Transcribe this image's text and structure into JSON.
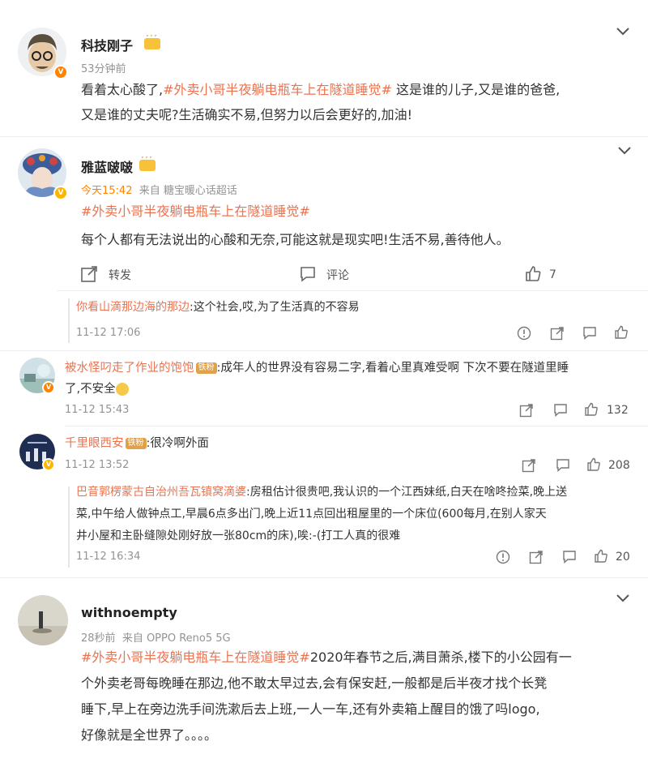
{
  "post1": {
    "username": "科技刚子",
    "time": "53分钟前",
    "body_prefix": "看着太心酸了,",
    "hashtag": "#外卖小哥半夜躺电瓶车上在隧道睡觉#",
    "body_suffix": " 这是谁的儿子,又是谁的爸爸,",
    "body_line2": "又是谁的丈夫呢?生活确实不易,但努力以后会更好的,加油!"
  },
  "post2": {
    "username": "雅蓝啵啵",
    "time": "今天15:42",
    "source": "来自 糖宝暖心话超话",
    "hashtag": "#外卖小哥半夜躺电瓶车上在隧道睡觉#",
    "body": "每个人都有无法说出的心酸和无奈,可能这就是现实吧!生活不易,善待他人。",
    "actions": {
      "repost": "转发",
      "comment": "评论",
      "like_count": "7"
    },
    "reply": {
      "name": "你看山滴那边海的那边",
      "text": ":这个社会,哎,为了生活真的不容易",
      "time": "11-12 17:06"
    }
  },
  "comment1": {
    "name": "被水怪叼走了作业的饱饱",
    "fan_tag": "铁粉",
    "text_line1": ":成年人的世界没有容易二字,看着心里真难受啊 下次不要在隧道里睡",
    "text_line2": "了,不安全",
    "time": "11-12 15:43",
    "like_count": "132"
  },
  "comment2": {
    "name": "千里眼西安",
    "fan_tag": "铁粉",
    "text": ":很冷啊外面",
    "time": "11-12 13:52",
    "like_count": "208",
    "reply": {
      "name": "巴音郭楞蒙古自治州吾瓦镇窝滴婆",
      "line1": ":房租估计很贵吧,我认识的一个江西妹纸,白天在啥咚捡菜,晚上送",
      "line2": "菜,中午给人做钟点工,早晨6点多出门,晚上近11点回出租屋里的一个床位(600每月,在别人家天",
      "line3": "井小屋和主卧缝隙处刚好放一张80cm的床),唉:-(打工人真的很难",
      "time": "11-12 16:34",
      "like_count": "20"
    }
  },
  "post3": {
    "username": "withnoempty",
    "time": "28秒前",
    "source": "来自 OPPO Reno5 5G",
    "hashtag": "#外卖小哥半夜躺电瓶车上在隧道睡觉#",
    "line1_suffix": "2020年春节之后,满目萧杀,楼下的小公园有一",
    "line2": "个外卖老哥每晚睡在那边,他不敢太早过去,会有保安赶,一般都是后半夜才找个长凳",
    "line3": "睡下,早上在旁边洗手间洗漱后去上班,一人一车,还有外卖箱上醒目的饿了吗logo,",
    "line4": "好像就是全世界了。。。。"
  },
  "colors": {
    "link": "#eb7350",
    "accent": "#ff8200",
    "meta": "#939393"
  }
}
